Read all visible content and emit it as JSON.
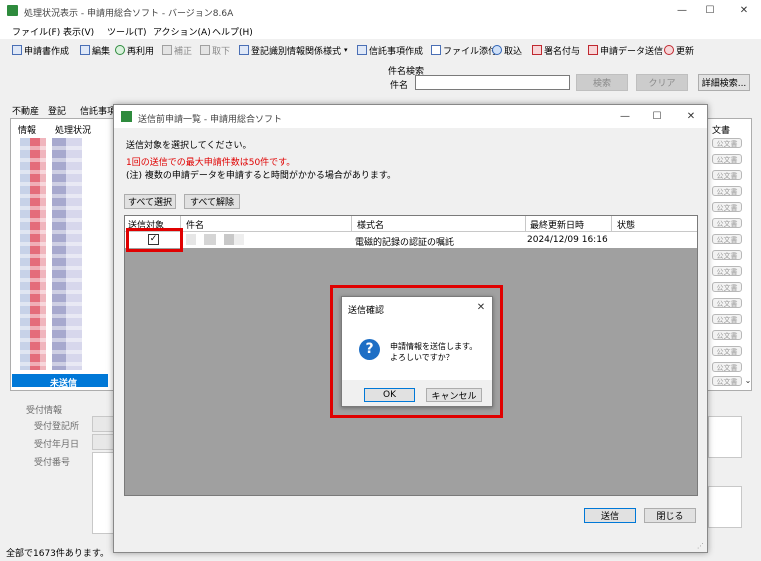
{
  "main_window": {
    "title": "処理状況表示 - 申請用総合ソフト - バージョン8.6A",
    "menu": [
      "ファイル(F)",
      "表示(V)",
      "ツール(T)",
      "アクション(A)",
      "ヘルプ(H)"
    ],
    "toolbar": [
      "申請書作成",
      "編集",
      "再利用",
      "補正",
      "取下",
      "登記識別情報関係様式",
      "信託事項作成",
      "ファイル添付",
      "取込",
      "署名付与",
      "申請データ送信",
      "更新"
    ],
    "search": {
      "section_label": "件名検索",
      "field_label": "件名",
      "value": "",
      "search_button": "検索",
      "clear_button": "クリア",
      "detail_button": "詳細検索..."
    },
    "tabs": [
      "不動産",
      "登記",
      "信託事項"
    ],
    "list_headers": [
      "情報",
      "処理状況",
      "文書"
    ],
    "selected_row_status": "未送信",
    "row_button_label": "公文書",
    "receipt": {
      "section_label": "受付情報",
      "fields": [
        "受付登記所",
        "受付年月日",
        "受付番号"
      ]
    },
    "status_bar": "全部で1673件あります。"
  },
  "send_window": {
    "title": "送信前申請一覧 - 申請用総合ソフト",
    "instruction": "送信対象を選択してください。",
    "warning": "1回の送信での最大申請件数は50件です。",
    "note": "(注) 複数の申請データを申請すると時間がかかる場合があります。",
    "select_all_button": "すべて選択",
    "deselect_all_button": "すべて解除",
    "table": {
      "headers": [
        "送信対象",
        "件名",
        "様式名",
        "最終更新日時",
        "状態"
      ],
      "rows": [
        {
          "checked": true,
          "subject": "",
          "form_name": "電磁的記録の認証の嘱託",
          "updated": "2024/12/09 16:16",
          "status": ""
        }
      ]
    },
    "send_button": "送信",
    "close_button": "閉じる"
  },
  "confirm_dialog": {
    "title": "送信確認",
    "message_line1": "申請情報を送信します。",
    "message_line2": "よろしいですか？",
    "ok_button": "OK",
    "cancel_button": "キャンセル"
  },
  "colors": {
    "highlight_red": "#e00000",
    "warning_text": "#e00000",
    "selected_row": "#0078d7",
    "grid_gray": "#a0a0a0",
    "dialog_border": "#7a7a7a",
    "question_icon": "#1d6ec5"
  }
}
